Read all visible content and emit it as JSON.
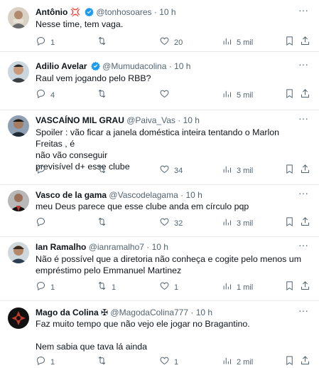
{
  "tweets": [
    {
      "name": "Antônio",
      "name_emoji": "💢",
      "handle": "@tonhosoares",
      "dot": "·",
      "time": "10 h",
      "verified": true,
      "lines": [
        "Nesse time, tem vaga."
      ],
      "replies": "1",
      "retweets": "",
      "likes": "20",
      "views": "5 mil"
    },
    {
      "name": "Adilio Avelar",
      "handle": "@Mumudacolina",
      "dot": "·",
      "time": "10 h",
      "verified": true,
      "lines": [
        "Raul vem jogando pelo RBB?"
      ],
      "replies": "4",
      "retweets": "",
      "likes": "",
      "views": "5 mil"
    },
    {
      "name": "VASCAÍNO MIL GRAU",
      "handle": "@Paiva_Vas",
      "dot": "·",
      "time": "10 h",
      "verified": false,
      "lines": [
        "Spoiler : vão ficar a janela doméstica inteira tentando o Marlon Freitas , é",
        "não vão conseguir",
        "previsível d+ esse clube"
      ],
      "replies": "",
      "retweets": "",
      "likes": "34",
      "views": "3 mil"
    },
    {
      "name": "Vasco de la gama",
      "handle": "@Vascodelagama",
      "dot": "·",
      "time": "10 h",
      "verified": false,
      "lines": [
        "meu Deus parece que esse clube anda em círculo pqp"
      ],
      "replies": "",
      "retweets": "",
      "likes": "32",
      "views": "3 mil"
    },
    {
      "name": "Ian Ramalho",
      "handle": "@ianramalho7",
      "dot": "·",
      "time": "10 h",
      "verified": false,
      "lines": [
        "Não é possível que a diretoria não conheça e cogite pelo menos um",
        "empréstimo pelo Emmanuel Martinez"
      ],
      "replies": "1",
      "retweets": "1",
      "likes": "1",
      "views": "1 mil"
    },
    {
      "name": "Mago da Colina",
      "name_emoji": "✠",
      "handle": "@MagodaColina777",
      "dot": "·",
      "time": "10 h",
      "verified": false,
      "lines": [
        "Faz muito tempo que não vejo ele jogar no Bragantino.",
        "",
        "Nem sabia que tava lá ainda"
      ],
      "replies": "1",
      "retweets": "",
      "likes": "1",
      "views": "2 mil"
    }
  ],
  "icons": {
    "more": "more-horizontal-icon",
    "reply": "reply-icon",
    "retweet": "retweet-icon",
    "like": "heart-icon",
    "views": "views-icon",
    "bookmark": "bookmark-icon",
    "share": "share-icon",
    "verified": "verified-badge-icon"
  },
  "colors": {
    "text": "#0f1419",
    "secondary": "#536471",
    "verified": "#1d9bf0",
    "divider": "#e7e9ea"
  }
}
